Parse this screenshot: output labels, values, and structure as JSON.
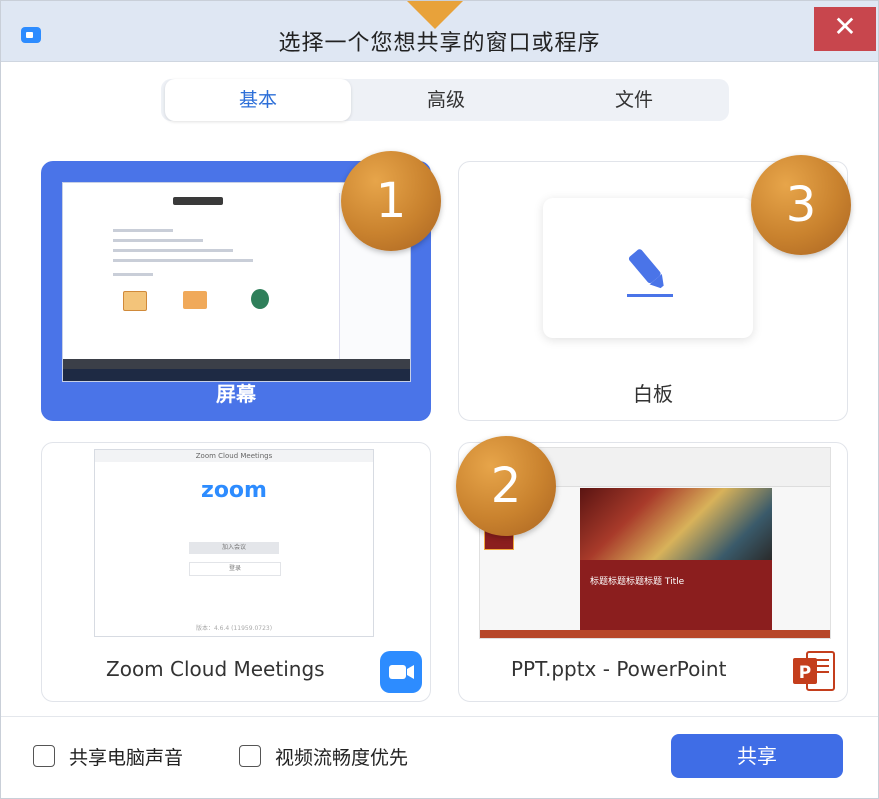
{
  "window": {
    "title": "选择一个您想共享的窗口或程序",
    "close_label": "✕"
  },
  "tabs": [
    {
      "label": "基本",
      "active": true
    },
    {
      "label": "高级",
      "active": false
    },
    {
      "label": "文件",
      "active": false
    }
  ],
  "cards": {
    "screen": {
      "label": "屏幕",
      "selected": true
    },
    "whiteboard": {
      "label": "白板",
      "selected": false
    },
    "zoom": {
      "label": "Zoom Cloud Meetings",
      "thumb_title": "Zoom Cloud Meetings",
      "thumb_logo": "zoom",
      "thumb_join": "加入会议",
      "thumb_signin": "登录",
      "thumb_version": "版本：4.6.4 (11959.0723)"
    },
    "ppt": {
      "label": "PPT.pptx - PowerPoint",
      "slide_title": "标题标题标题标题 Title"
    }
  },
  "badges": [
    "1",
    "2",
    "3"
  ],
  "footer": {
    "share_audio_label": "共享电脑声音",
    "video_priority_label": "视频流畅度优先",
    "share_button": "共享"
  },
  "colors": {
    "accent": "#4a74e8",
    "badge": "#c9822e",
    "close": "#c8464d",
    "title_bar": "#dfe7f3"
  }
}
